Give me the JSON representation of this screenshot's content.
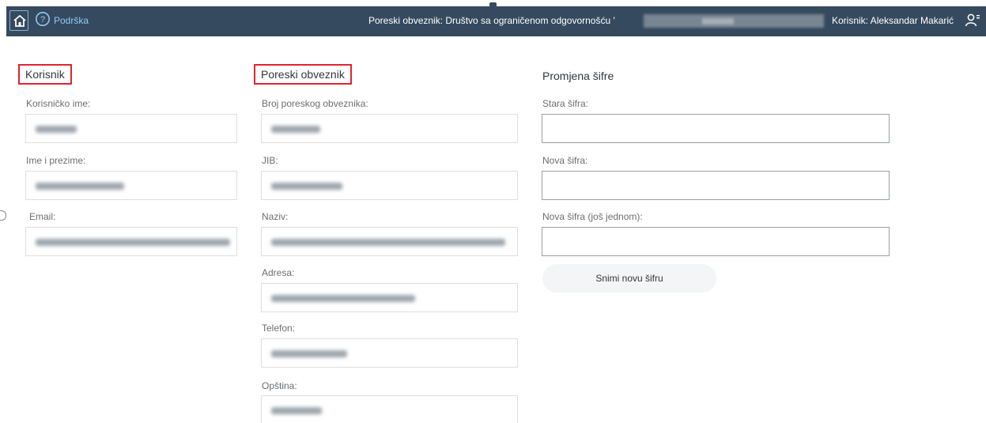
{
  "header": {
    "help_label": "Podrška",
    "taxpayer_label": "Poreski obveznik: Društvo sa ograničenom odgovornošću '",
    "user_label": "Korisnik: Aleksandar Makarić",
    "icons": [
      "home-icon",
      "help-icon",
      "user-icon"
    ]
  },
  "user_section": {
    "title": "Korisnik",
    "fields": [
      {
        "label": "Korisničko ime:"
      },
      {
        "label": "Ime i prezime:"
      },
      {
        "label": "Email:"
      }
    ]
  },
  "taxpayer_section": {
    "title": "Poreski obveznik",
    "fields": [
      {
        "label": "Broj poreskog obveznika:"
      },
      {
        "label": "JIB:"
      },
      {
        "label": "Naziv:"
      },
      {
        "label": "Adresa:"
      },
      {
        "label": "Telefon:"
      },
      {
        "label": "Opština:"
      }
    ]
  },
  "password_section": {
    "title": "Promjena šifre",
    "old_label": "Stara šifra:",
    "new_label": "Nova šifra:",
    "repeat_label": "Nova šifra (još jednom):",
    "save_label": "Snimi novu šifru"
  },
  "colors": {
    "header_bg": "#354a5f",
    "highlight": "#e0242f",
    "link": "#91c8f6"
  }
}
